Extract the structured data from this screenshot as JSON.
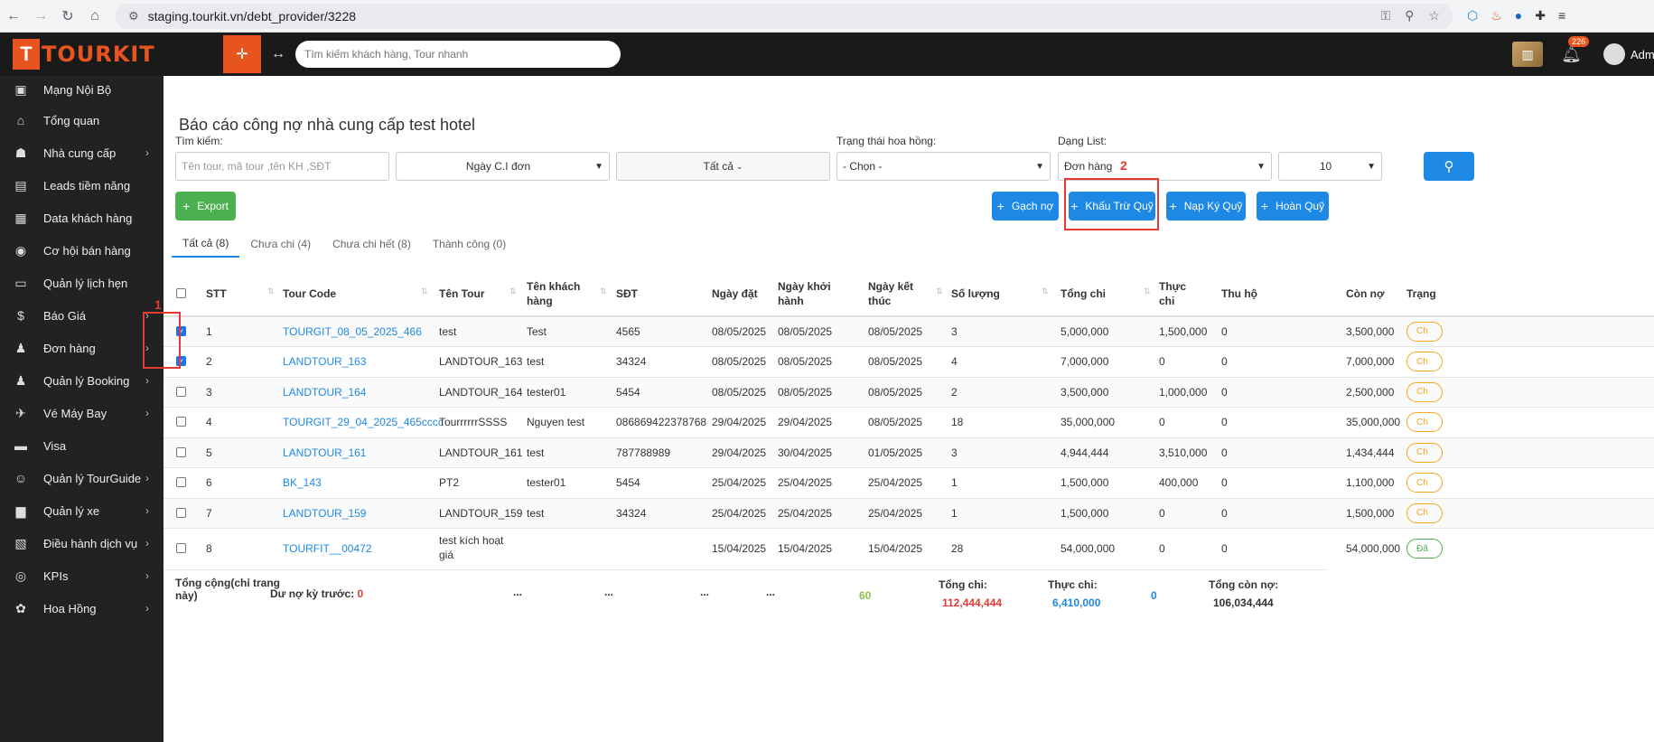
{
  "browser": {
    "url": "staging.tourkit.vn/debt_provider/3228"
  },
  "header": {
    "logo_mark": "T",
    "logo_text": "TOURKIT",
    "search_placeholder": "Tìm kiếm khách hàng, Tour nhanh",
    "notif_count": "226",
    "user": "Admin"
  },
  "sidebar": {
    "items": [
      {
        "label": "Mạng Nội Bộ",
        "icon": "briefcase-icon",
        "glyph": "▣",
        "chevron": false
      },
      {
        "label": "Tổng quan",
        "icon": "home-icon",
        "glyph": "⌂",
        "chevron": false
      },
      {
        "label": "Nhà cung cấp",
        "icon": "users-icon",
        "glyph": "☗",
        "chevron": true
      },
      {
        "label": "Leads tiềm năng",
        "icon": "layers-icon",
        "glyph": "▤",
        "chevron": false
      },
      {
        "label": "Data khách hàng",
        "icon": "database-icon",
        "glyph": "▦",
        "chevron": false
      },
      {
        "label": "Cơ hội bán hàng",
        "icon": "opportunity-icon",
        "glyph": "◉",
        "chevron": false
      },
      {
        "label": "Quản lý lịch hẹn",
        "icon": "cskh-icon",
        "glyph": "▭",
        "chevron": false
      },
      {
        "label": "Báo Giá",
        "icon": "quote-icon",
        "glyph": "$",
        "chevron": true
      },
      {
        "label": "Đơn hàng",
        "icon": "order-icon",
        "glyph": "♟",
        "chevron": true
      },
      {
        "label": "Quản lý Booking",
        "icon": "booking-icon",
        "glyph": "♟",
        "chevron": true
      },
      {
        "label": "Vé Máy Bay",
        "icon": "plane-icon",
        "glyph": "✈",
        "chevron": true
      },
      {
        "label": "Visa",
        "icon": "visa-icon",
        "glyph": "▬",
        "chevron": false
      },
      {
        "label": "Quản lý TourGuide",
        "icon": "guide-icon",
        "glyph": "☺",
        "chevron": true
      },
      {
        "label": "Quản lý xe",
        "icon": "bus-icon",
        "glyph": "▆",
        "chevron": true
      },
      {
        "label": "Điều hành dịch vụ",
        "icon": "service-icon",
        "glyph": "▧",
        "chevron": true
      },
      {
        "label": "KPIs",
        "icon": "kpi-icon",
        "glyph": "◎",
        "chevron": true
      },
      {
        "label": "Hoa Hồng",
        "icon": "commission-icon",
        "glyph": "✿",
        "chevron": true
      }
    ]
  },
  "main": {
    "title": "Báo cáo công nợ nhà cung cấp test hotel",
    "filters": {
      "search_label": "Tìm kiếm:",
      "search_placeholder": "Tên tour, mã tour ,tên KH ,SĐT",
      "date_type": "Ngày C.I đơn",
      "all": "Tất cả",
      "commission_label": "Trạng thái hoa hồng:",
      "commission_value": "- Chọn -",
      "list_label": "Dạng List:",
      "list_value": "Đơn hàng",
      "page_size": "10"
    },
    "buttons": {
      "export": "Export",
      "gach_no": "Gạch nợ",
      "khau_tru_quy": "Khấu Trừ Quỹ",
      "nap_ky_quy": "Nạp Ký Quỹ",
      "hoan_quy": "Hoàn Quỹ"
    },
    "annotations": {
      "one": "1",
      "two": "2"
    },
    "tabs": [
      "Tất cả (8)",
      "Chưa chi (4)",
      "Chưa chi hết (8)",
      "Thành công (0)"
    ],
    "columns": {
      "stt": "STT",
      "tour_code": "Tour Code",
      "ten_tour": "Tên Tour",
      "ten_kh_1": "Tên khách",
      "ten_kh_2": "hàng",
      "sdt": "SĐT",
      "ngay_dat": "Ngày đặt",
      "ngay_khoi_1": "Ngày khởi",
      "ngay_khoi_2": "hành",
      "ngay_kt_1": "Ngày kết",
      "ngay_kt_2": "thúc",
      "so_luong": "Số lượng",
      "tong_chi": "Tổng chi",
      "thuc_chi_1": "Thực",
      "thuc_chi_2": "chi",
      "thu_ho": "Thu hộ",
      "con_no": "Còn nợ",
      "trang_thai": "Trạng"
    },
    "rows": [
      {
        "checked": true,
        "stt": "1",
        "code": "TOURGIT_08_05_2025_466",
        "tour": "test",
        "tour2": "",
        "kh": "Test",
        "sdt": "4565",
        "dat": "08/05/2025",
        "khoi": "08/05/2025",
        "kt": "08/05/2025",
        "sl": "3",
        "tong": "5,000,000",
        "thuc": "1,500,000",
        "thuho": "0",
        "conno": "3,500,000",
        "status": "Ch"
      },
      {
        "checked": true,
        "stt": "2",
        "code": "LANDTOUR_163",
        "tour": "LANDTOUR_163",
        "tour2": "",
        "kh": "test",
        "sdt": "34324",
        "dat": "08/05/2025",
        "khoi": "08/05/2025",
        "kt": "08/05/2025",
        "sl": "4",
        "tong": "7,000,000",
        "thuc": "0",
        "thuho": "0",
        "conno": "7,000,000",
        "status": "Ch"
      },
      {
        "checked": false,
        "stt": "3",
        "code": "LANDTOUR_164",
        "tour": "LANDTOUR_164",
        "tour2": "",
        "kh": "tester01",
        "sdt": "5454",
        "dat": "08/05/2025",
        "khoi": "08/05/2025",
        "kt": "08/05/2025",
        "sl": "2",
        "tong": "3,500,000",
        "thuc": "1,000,000",
        "thuho": "0",
        "conno": "2,500,000",
        "status": "Ch"
      },
      {
        "checked": false,
        "stt": "4",
        "code": "TOURGIT_29_04_2025_465cccc",
        "tour": "TourrrrrrSSSS",
        "tour2": "",
        "kh": "Nguyen test",
        "sdt": "086869422378768",
        "dat": "29/04/2025",
        "khoi": "29/04/2025",
        "kt": "08/05/2025",
        "sl": "18",
        "tong": "35,000,000",
        "thuc": "0",
        "thuho": "0",
        "conno": "35,000,000",
        "status": "Ch"
      },
      {
        "checked": false,
        "stt": "5",
        "code": "LANDTOUR_161",
        "tour": "LANDTOUR_161",
        "tour2": "",
        "kh": "test",
        "sdt": "787788989",
        "dat": "29/04/2025",
        "khoi": "30/04/2025",
        "kt": "01/05/2025",
        "sl": "3",
        "tong": "4,944,444",
        "thuc": "3,510,000",
        "thuho": "0",
        "conno": "1,434,444",
        "status": "Ch"
      },
      {
        "checked": false,
        "stt": "6",
        "code": "BK_143",
        "tour": "PT2",
        "tour2": "",
        "kh": "tester01",
        "sdt": "5454",
        "dat": "25/04/2025",
        "khoi": "25/04/2025",
        "kt": "25/04/2025",
        "sl": "1",
        "tong": "1,500,000",
        "thuc": "400,000",
        "thuho": "0",
        "conno": "1,100,000",
        "status": "Ch"
      },
      {
        "checked": false,
        "stt": "7",
        "code": "LANDTOUR_159",
        "tour": "LANDTOUR_159",
        "tour2": "",
        "kh": "test",
        "sdt": "34324",
        "dat": "25/04/2025",
        "khoi": "25/04/2025",
        "kt": "25/04/2025",
        "sl": "1",
        "tong": "1,500,000",
        "thuc": "0",
        "thuho": "0",
        "conno": "1,500,000",
        "status": "Ch"
      },
      {
        "checked": false,
        "stt": "8",
        "code": "TOURFIT__00472",
        "tour": "test kích hoạt",
        "tour2": "giá",
        "kh": "",
        "sdt": "",
        "dat": "15/04/2025",
        "khoi": "15/04/2025",
        "kt": "15/04/2025",
        "sl": "28",
        "tong": "54,000,000",
        "thuc": "0",
        "thuho": "0",
        "conno": "54,000,000",
        "status": "Đã"
      }
    ],
    "footer": {
      "total_label_1": "Tổng cộng(chỉ trang",
      "total_label_2": "này)",
      "prev_label": "Dư nợ kỳ trước:",
      "prev_value": "0",
      "dots": "...",
      "qty": "60",
      "tong_chi_label": "Tổng chi:",
      "tong_chi_value": "112,444,444",
      "thuc_chi_label": "Thực chi:",
      "thuc_chi_value": "6,410,000",
      "thu_ho_value": "0",
      "con_no_label": "Tổng còn nợ:",
      "con_no_value": "106,034,444"
    }
  }
}
